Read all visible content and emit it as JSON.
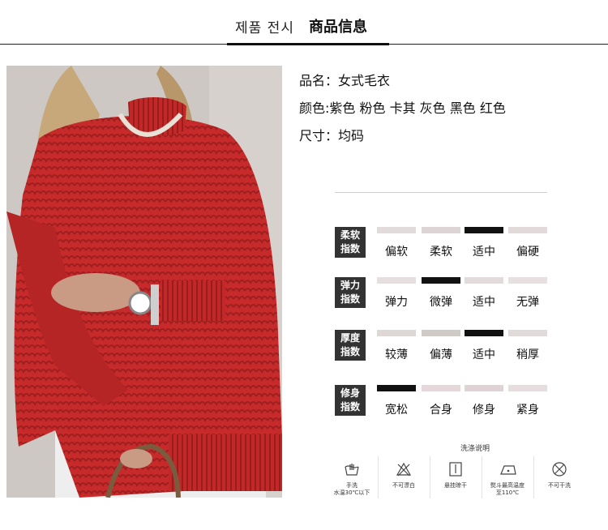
{
  "header": {
    "subtitle": "제품 전시",
    "title": "商品信息"
  },
  "info": {
    "name_line": "品名：女式毛衣",
    "colors_line": "颜色:紫色 粉色 卡其 灰色 黑色 红色",
    "size_line": "尺寸：均码"
  },
  "metrics": [
    {
      "tag1": "柔软",
      "tag2": "指数",
      "options": [
        "偏软",
        "柔软",
        "适中",
        "偏硬"
      ],
      "selected_index": 2
    },
    {
      "tag1": "弹力",
      "tag2": "指数",
      "options": [
        "弹力",
        "微弹",
        "适中",
        "无弹"
      ],
      "selected_index": 1
    },
    {
      "tag1": "厚度",
      "tag2": "指数",
      "options": [
        "较薄",
        "偏薄",
        "适中",
        "稍厚"
      ],
      "selected_index": 2
    },
    {
      "tag1": "修身",
      "tag2": "指数",
      "options": [
        "宽松",
        "合身",
        "修身",
        "紧身"
      ],
      "selected_index": 0
    }
  ],
  "care": {
    "title": "洗涤说明",
    "items": [
      {
        "icon": "hand-wash-icon",
        "label1": "手洗",
        "label2": "水温30℃以下"
      },
      {
        "icon": "no-bleach-icon",
        "label1": "不可漂白",
        "label2": ""
      },
      {
        "icon": "hang-dry-icon",
        "label1": "悬挂晾干",
        "label2": ""
      },
      {
        "icon": "iron-icon",
        "label1": "熨斗最高温度",
        "label2": "至110℃"
      },
      {
        "icon": "no-dry-clean-icon",
        "label1": "不可干洗",
        "label2": ""
      }
    ]
  },
  "colors": {
    "sweater": "#c62a2a",
    "tag_bg": "#333333",
    "selected_bar": "#111111"
  }
}
